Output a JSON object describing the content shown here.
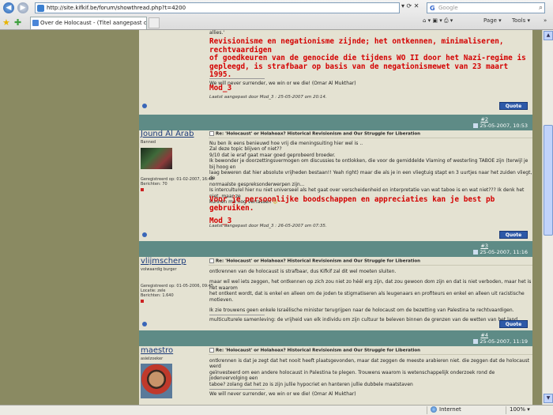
{
  "browser": {
    "address": "http://site.kifkif.be/forum/showthread.php?t=4200",
    "search_placeholder": "Google",
    "search_letter": "G",
    "tab_title": "Over de Holocaust - (Titel aangepast door...",
    "back": "◀",
    "forward": "▶",
    "addr_tools": "▾ ⟳ ✕",
    "cmd_icons": "⌂ ▾   ▣ ▾   ⎙ ▾",
    "page_menu": "Page ▾",
    "tools_menu": "Tools ▾",
    "chevron": "»"
  },
  "status": {
    "zone": "Internet",
    "zoom": "100% ▾"
  },
  "posts": [
    {
      "body_lines": [
        "allies.'"
      ],
      "mod_lines": [
        "Revisionisme en negationisme zijnde; het ontkennen, minimaliseren, rechtvaardigen",
        "of goedkeuren van de genocide die tijdens WO II door het Nazi-regime is",
        "gepleegd, is strafbaar op basis van de negationismewet van 23 maart 1995.",
        "",
        "Mod_3"
      ],
      "signature": "We will never surrender, we win or we die! (Omar Al Mukthar)",
      "edited": "Laatst aangepast door Mod_3 : 25-05-2007 om 20:14."
    },
    {
      "num": "#2",
      "date": "25-05-2007, 10:53",
      "author": "Jound Al Arab",
      "user_title": "Banned",
      "info": [
        "Geregistreerd op: 01-02-2007, 16:46",
        "Berichten: 70"
      ],
      "title": "Re: 'Holocaust' or Holahoax? Historical Revisionism and Our Struggle for Liberation",
      "body_lines": [
        "Nu ben ik eens benieuwd hoe vrij die meningsuiting hier wel is ..",
        "Zal deze topic blijven of niet??",
        "9/10 dat ie eraf gaat maar goed geprobeerd broeder.",
        "Ik bewonder je doorzettingsvermogen om discussies te ontlokken, die voor de gemiddelde Vlaming of westerling TABOE zijn (terwijl je bij hoog en",
        "laag beweren dat hier absolute vrijheden bestaan!! Yeah right) maar die als je in een vliegtuig stapt en 3 uurtjes naar het zuiden vliegt, de",
        "normaalste gespreksonderwerpen zijn...",
        "Is interculturel hier nu niet universeel als het gaat over verscheidenheid en interpretatie van wat taboe is en wat niet??? Ik denk het niet, maar ze",
        "kunnen me nog verrassen"
      ],
      "mod_lines": [
        "Voor je persoonlijke boodschappen en appreciaties kan je best pb gebruiken.",
        "",
        "Mod_3"
      ],
      "edited": "Laatst aangepast door Mod_3 : 26-05-2007 om 07:35."
    },
    {
      "num": "#3",
      "date": "25-05-2007, 11:16",
      "author": "vlijmscherp",
      "user_title": "volwaardig burger",
      "info": [
        "Geregistreerd op: 01-05-2006, 09:45",
        "Locatie: zele",
        "Berichten: 1.640"
      ],
      "title": "Re: 'Holocaust' or Holahoax? Historical Revisionism and Our Struggle for Liberation",
      "body_lines": [
        "ontkrennen van de holocaust is strafbaar, dus Kifkif zal dit wel moeten sluiten.",
        "",
        "maar wil wel iets zeggen, het ontkennen op zich zou niet zo héél erg zijn, dat zou gewoon dom zijn en dat is niet verboden, maar het is het waarom",
        "het ontkent wordt, dat is enkel en alleen om de joden te stigmatiseren als leugenaars en profiteurs en enkel en alleen uit racistische motieven.",
        "",
        "Ik zie trouwens geen enkele Israëlische minister terugrijpen naar de holocaust om de bezetting van Palestina te rechtvaardigen."
      ],
      "signature": "multiculturele samenleving: de vrijheid van elk individu om zijn cultuur te beleven binnen de grenzen van de wetten van het land."
    },
    {
      "num": "#4",
      "date": "25-05-2007, 11:19",
      "author": "maestro",
      "user_title": "asielzoeker",
      "title": "Re: 'Holocaust' or Holahoax? Historical Revisionism and Our Struggle for Liberation",
      "body_lines": [
        "ontkrennen is dat je zegt dat het nooit heeft plaatsgevonden, maar dat zeggen de meeste arabieren niet. die zeggen dat de holocaust werd",
        "geïnvesteerd om een andere holocaust in Palestina te plegen. Trouwens waarom is wetenschappelijk onderzoek rond de jodenvervolging een",
        "taboe? zolang dat het zo is zijn jullie hypocriet en hanteren jullie dubbele maatstaven"
      ],
      "signature": "We will never surrender, we win or we die! (Omar Al Mukthar)"
    }
  ],
  "quote_label": "Quote",
  "scroll": {
    "up": "▲",
    "down": "▼"
  }
}
